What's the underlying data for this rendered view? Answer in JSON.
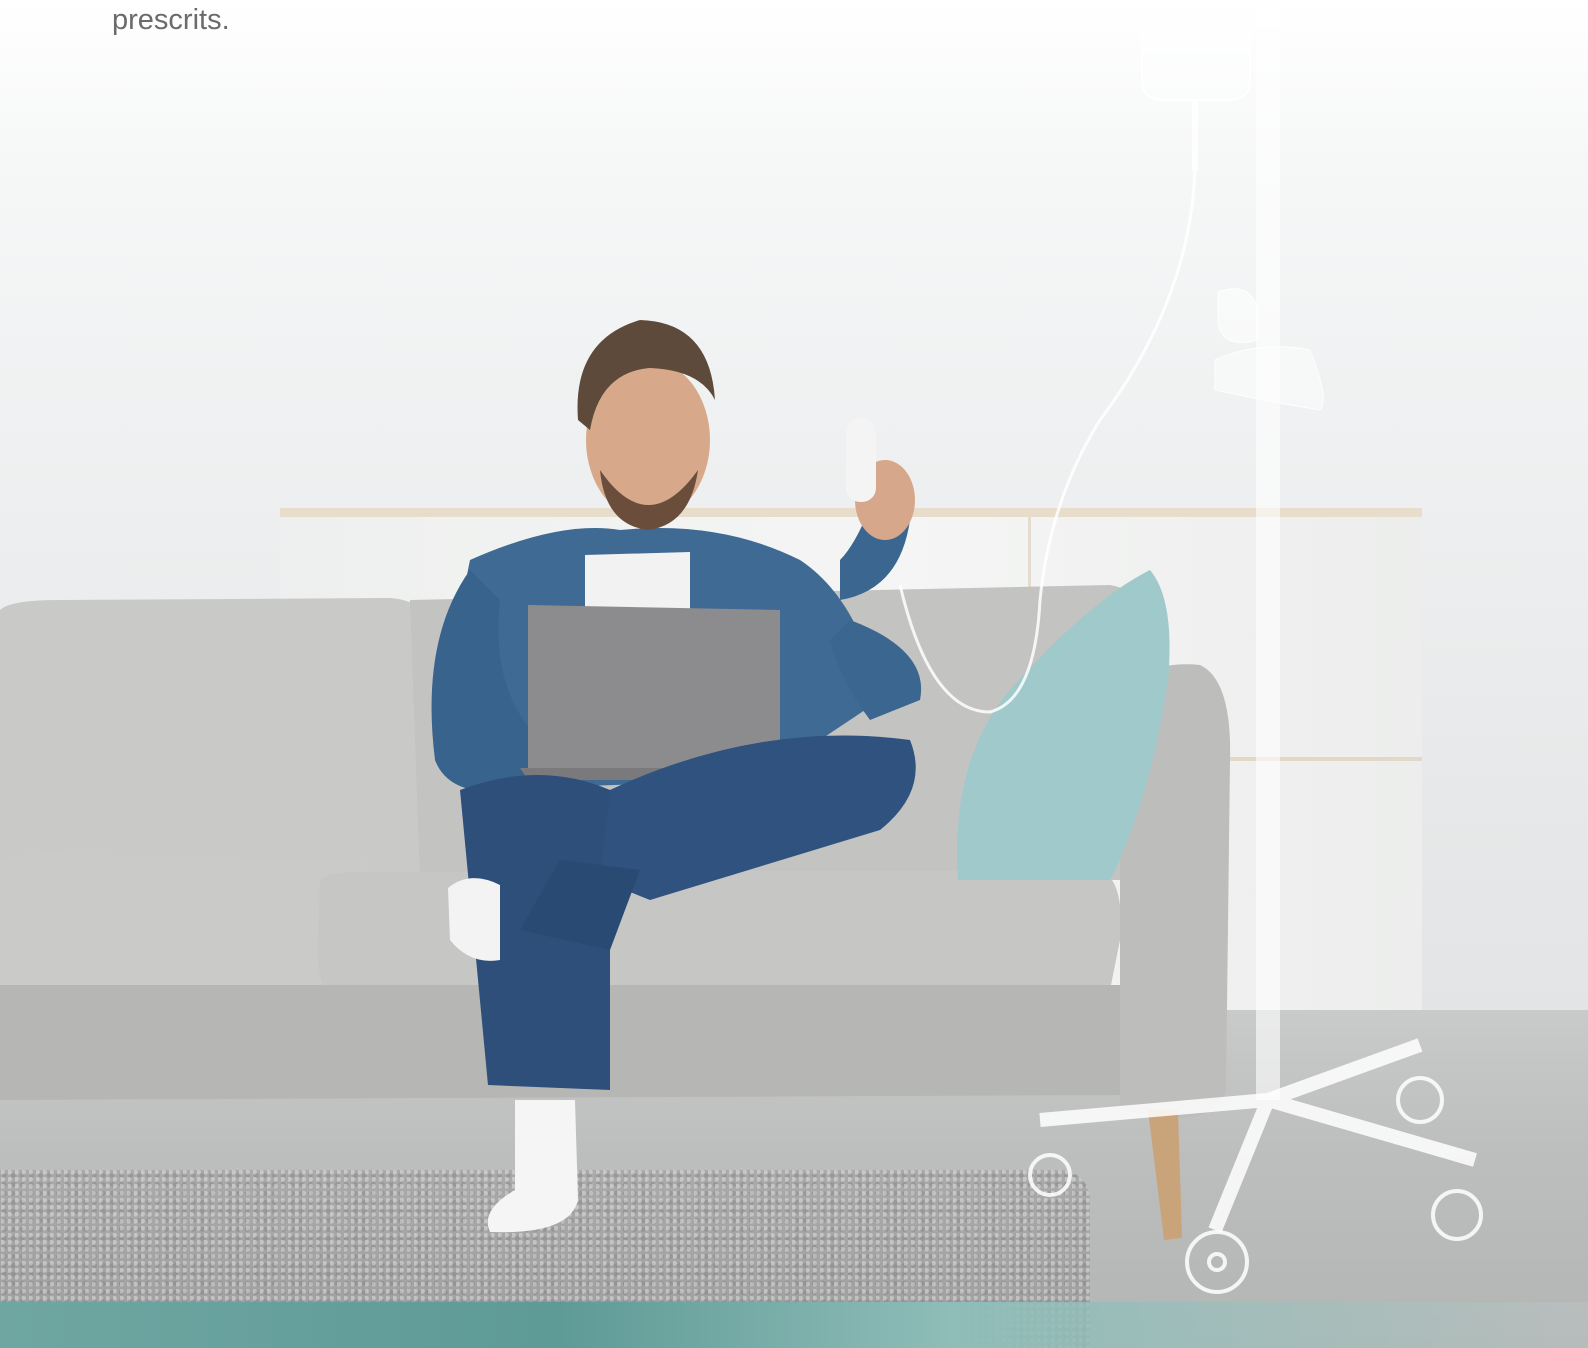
{
  "caption": {
    "partial_line": "...",
    "last_line": "prescrits."
  }
}
